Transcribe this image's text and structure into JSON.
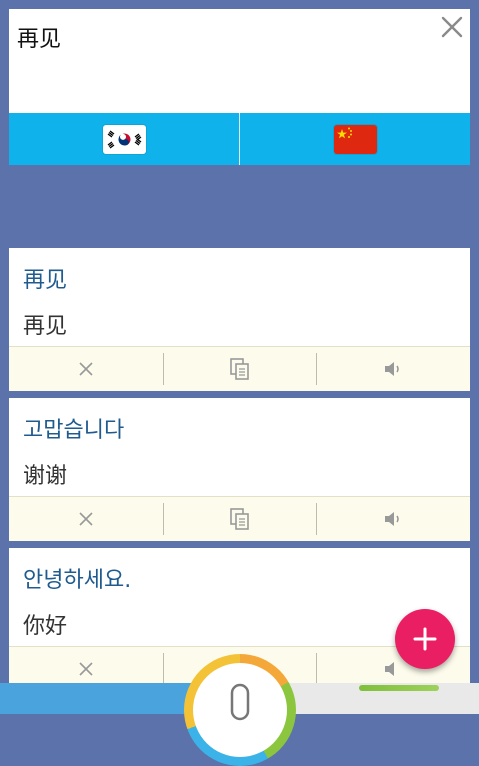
{
  "input": {
    "text": "再见"
  },
  "languages": {
    "source": {
      "icon": "korea-flag-icon"
    },
    "target": {
      "icon": "china-flag-icon"
    }
  },
  "history": [
    {
      "source_text": "再见",
      "translated_text": "再见"
    },
    {
      "source_text": "고맙습니다",
      "translated_text": "谢谢"
    },
    {
      "source_text": "안녕하세요.",
      "translated_text": "你好"
    }
  ],
  "actions": {
    "delete_icon": "close-icon",
    "copy_icon": "copy-icon",
    "speak_icon": "speaker-icon"
  },
  "colors": {
    "background": "#5b72ab",
    "language_bar": "#0fb2ea",
    "source_text": "#1f5b8f",
    "fab": "#ea1f63",
    "action_bar": "#fdfcec"
  }
}
